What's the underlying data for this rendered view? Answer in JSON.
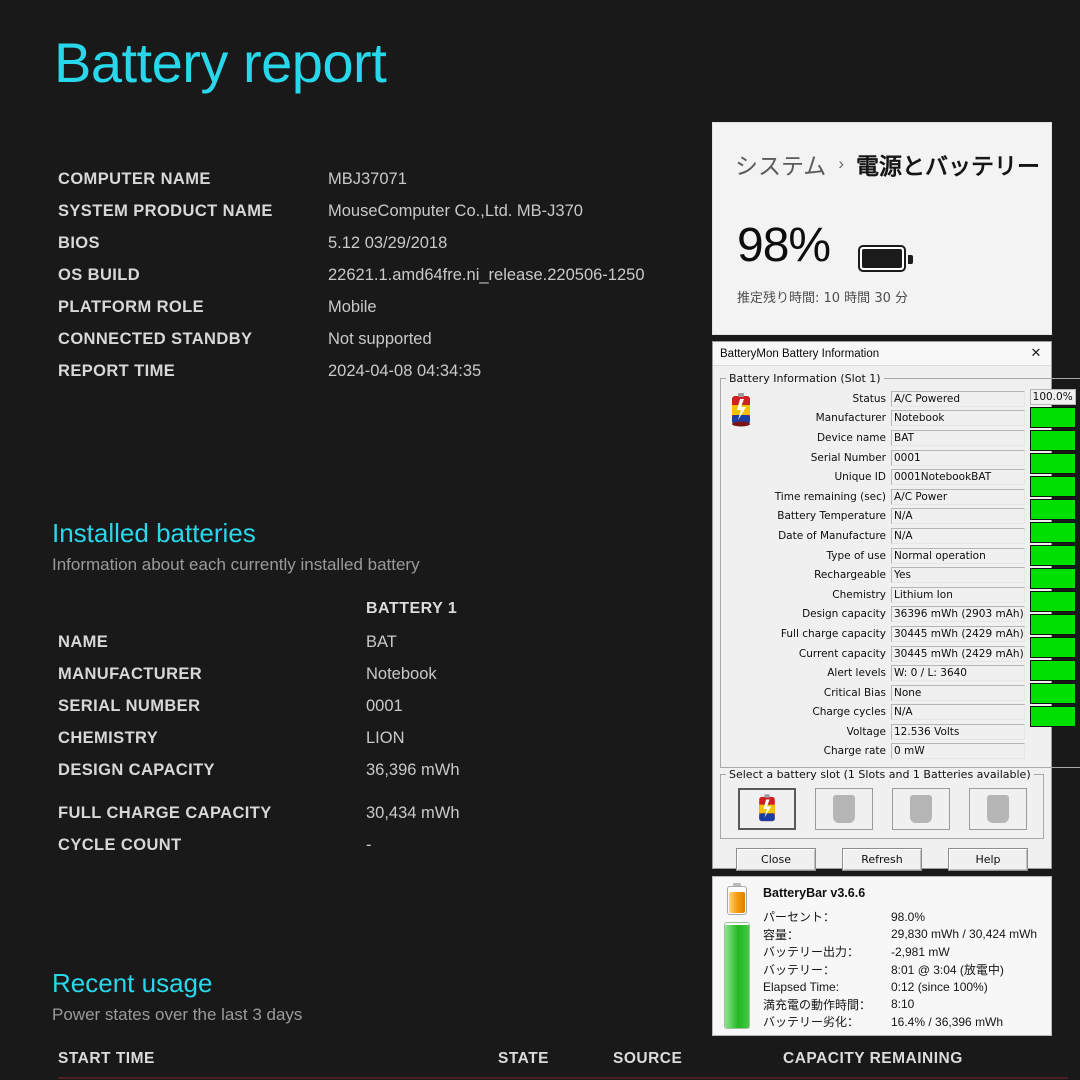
{
  "report": {
    "title": "Battery report",
    "system_info": [
      {
        "label": "COMPUTER NAME",
        "value": "MBJ37071"
      },
      {
        "label": "SYSTEM PRODUCT NAME",
        "value": "MouseComputer Co.,Ltd. MB-J370"
      },
      {
        "label": "BIOS",
        "value": "5.12 03/29/2018"
      },
      {
        "label": "OS BUILD",
        "value": "22621.1.amd64fre.ni_release.220506-1250"
      },
      {
        "label": "PLATFORM ROLE",
        "value": "Mobile"
      },
      {
        "label": "CONNECTED STANDBY",
        "value": "Not supported"
      },
      {
        "label": "REPORT TIME",
        "value": "2024-04-08  04:34:35"
      }
    ],
    "installed": {
      "heading": "Installed batteries",
      "subheading": "Information about each currently installed battery",
      "column_header": "BATTERY 1",
      "rows": [
        {
          "label": "NAME",
          "value": "BAT"
        },
        {
          "label": "MANUFACTURER",
          "value": "Notebook"
        },
        {
          "label": "SERIAL NUMBER",
          "value": "0001"
        },
        {
          "label": "CHEMISTRY",
          "value": "LION"
        },
        {
          "label": "DESIGN CAPACITY",
          "value": "36,396 mWh"
        },
        {
          "label": "FULL CHARGE CAPACITY",
          "value": "30,434 mWh"
        },
        {
          "label": "CYCLE COUNT",
          "value": "-"
        }
      ]
    },
    "recent_usage": {
      "heading": "Recent usage",
      "subheading": "Power states over the last 3 days",
      "columns": [
        "START TIME",
        "STATE",
        "SOURCE",
        "CAPACITY REMAINING"
      ]
    },
    "accent_color": "#28d7ea",
    "background_color": "#191919"
  },
  "settings": {
    "breadcrumb_parent": "システム",
    "breadcrumb_sep": "›",
    "breadcrumb_current": "電源とバッテリー",
    "percent": "98%",
    "battery_icon": "battery-full-icon",
    "estimate": "推定残り時間: 10 時間 30 分"
  },
  "batterymon": {
    "window_title": "BatteryMon Battery Information",
    "close_icon": "✕",
    "group_title": "Battery Information (Slot 1)",
    "fields": [
      {
        "label": "Status",
        "value": "A/C Powered"
      },
      {
        "label": "Manufacturer",
        "value": "Notebook"
      },
      {
        "label": "Device name",
        "value": "BAT"
      },
      {
        "label": "Serial Number",
        "value": "0001"
      },
      {
        "label": "Unique ID",
        "value": "0001NotebookBAT"
      },
      {
        "label": "Time remaining (sec)",
        "value": "A/C Power"
      },
      {
        "label": "Battery Temperature",
        "value": "N/A"
      },
      {
        "label": "Date of Manufacture",
        "value": "N/A"
      },
      {
        "label": "Type of use",
        "value": "Normal operation"
      },
      {
        "label": "Rechargeable",
        "value": "Yes"
      },
      {
        "label": "Chemistry",
        "value": "Lithium Ion"
      },
      {
        "label": "Design capacity",
        "value": "36396 mWh (2903 mAh)"
      },
      {
        "label": "Full charge capacity",
        "value": "30445 mWh (2429 mAh)"
      },
      {
        "label": "Current capacity",
        "value": "30445 mWh (2429 mAh)"
      },
      {
        "label": "Alert levels",
        "value": "W: 0 / L: 3640"
      },
      {
        "label": "Critical Bias",
        "value": "None"
      },
      {
        "label": "Charge cycles",
        "value": "N/A"
      },
      {
        "label": "Voltage",
        "value": "12.536 Volts"
      },
      {
        "label": "Charge rate",
        "value": "0 mW"
      }
    ],
    "gauge_percent": "100.0%",
    "gauge_segments": 14,
    "gauge_color": "#00e000",
    "slot_group_title": "Select a battery slot (1 Slots and 1 Batteries available)",
    "slots": [
      {
        "name": "slot-1",
        "occupied": true
      },
      {
        "name": "slot-2",
        "occupied": false
      },
      {
        "name": "slot-3",
        "occupied": false
      },
      {
        "name": "slot-4",
        "occupied": false
      }
    ],
    "buttons": [
      {
        "label": "Close",
        "accel": "C"
      },
      {
        "label": "Refresh",
        "accel": "R"
      },
      {
        "label": "Help",
        "accel": "H"
      }
    ]
  },
  "batterybar": {
    "title": "BatteryBar v3.6.6",
    "rows": [
      {
        "label": "パーセント：",
        "value": "98.0%"
      },
      {
        "label": "容量：",
        "value": "29,830 mWh / 30,424 mWh"
      },
      {
        "label": "バッテリー出力：",
        "value": "-2,981 mW"
      },
      {
        "label": "バッテリー：",
        "value": "8:01 @ 3:04 (放電中)"
      },
      {
        "label": "Elapsed Time:",
        "value": "0:12 (since 100%)"
      },
      {
        "label": "満充電の動作時間：",
        "value": "8:10"
      },
      {
        "label": "バッテリー劣化：",
        "value": "16.4% / 36,396 mWh"
      }
    ],
    "level_percent": 98
  }
}
